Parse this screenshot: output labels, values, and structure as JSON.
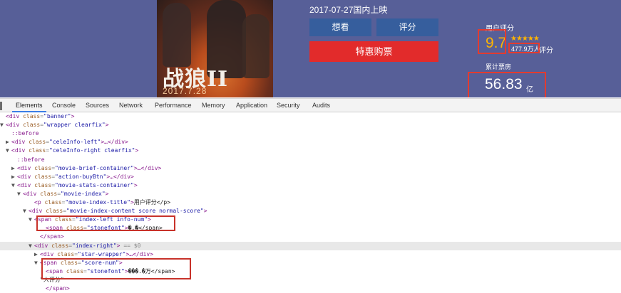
{
  "banner": {
    "poster": {
      "title_art": "战狼II",
      "date_art": "2017.7.28"
    },
    "release_text": "2017-07-27国内上映",
    "buttons": {
      "want": "想看",
      "rate": "评分",
      "buy": "特惠购票"
    },
    "score": {
      "title": "用户评分",
      "value": "9.7",
      "stars": "★★★★★",
      "count": "477.9万人",
      "count_suffix": "评分"
    },
    "box_office": {
      "title": "累计票房",
      "value": "56.83",
      "unit": "亿"
    },
    "colors": {
      "banner_bg": "#575f98",
      "button_blue": "#365e9d",
      "buy_red": "#e22b2b",
      "score_gold": "#ffb400",
      "highlight_red": "#e33b2f"
    }
  },
  "devtools": {
    "tabs": [
      "Elements",
      "Console",
      "Sources",
      "Network",
      "Performance",
      "Memory",
      "Application",
      "Security",
      "Audits"
    ],
    "active_tab": "Elements",
    "dom": [
      {
        "arrow": "",
        "pre": "<",
        "tag": "div",
        "attrs": [
          [
            "class",
            "banner"
          ]
        ],
        "post": ">",
        "text": ""
      },
      {
        "arrow": "▼",
        "pre": "<",
        "tag": "div",
        "attrs": [
          [
            "class",
            "wrapper clearfix"
          ]
        ],
        "post": ">",
        "text": ""
      },
      {
        "pseudo": "::before"
      },
      {
        "arrow": "▶",
        "pre": "<",
        "tag": "div",
        "attrs": [
          [
            "class",
            "celeInfo-left"
          ]
        ],
        "post": ">…</div>",
        "text": ""
      },
      {
        "arrow": "▼",
        "pre": "<",
        "tag": "div",
        "attrs": [
          [
            "class",
            "celeInfo-right clearfix"
          ]
        ],
        "post": ">",
        "text": ""
      },
      {
        "pseudo": "::before"
      },
      {
        "arrow": "▶",
        "pre": "<",
        "tag": "div",
        "attrs": [
          [
            "class",
            "movie-brief-container"
          ]
        ],
        "post": ">…</div>",
        "text": ""
      },
      {
        "arrow": "▶",
        "pre": "<",
        "tag": "div",
        "attrs": [
          [
            "class",
            "action-buyBtn"
          ]
        ],
        "post": ">…</div>",
        "text": ""
      },
      {
        "arrow": "▼",
        "pre": "<",
        "tag": "div",
        "attrs": [
          [
            "class",
            "movie-stats-container"
          ]
        ],
        "post": ">",
        "text": ""
      },
      {
        "arrow": "▼",
        "pre": "<",
        "tag": "div",
        "attrs": [
          [
            "class",
            "movie-index"
          ]
        ],
        "post": ">",
        "text": ""
      },
      {
        "arrow": "",
        "pre": "<",
        "tag": "p",
        "attrs": [
          [
            "class",
            "movie-index-title"
          ]
        ],
        "post": ">",
        "text": "用户评分</p>"
      },
      {
        "arrow": "▼",
        "pre": "<",
        "tag": "div",
        "attrs": [
          [
            "class",
            "movie-index-content score normal-score"
          ]
        ],
        "post": ">",
        "text": ""
      },
      {
        "arrow": "▼",
        "pre": "<",
        "tag": "span",
        "attrs": [
          [
            "class",
            "index-left info-num"
          ]
        ],
        "post": ">",
        "text": ""
      },
      {
        "arrow": "",
        "pre": "<",
        "tag": "span",
        "attrs": [
          [
            "class",
            "stonefont"
          ]
        ],
        "post": ">",
        "text": "�.�</span>"
      },
      {
        "arrow": "",
        "pre": "</",
        "tag": "span",
        "attrs": [],
        "post": ">",
        "text": ""
      },
      {
        "arrow": "▼",
        "pre": "<",
        "tag": "div",
        "attrs": [
          [
            "class",
            "index-right"
          ]
        ],
        "post": ">",
        "text": "",
        "suffix": " == $0"
      },
      {
        "arrow": "▶",
        "pre": "<",
        "tag": "div",
        "attrs": [
          [
            "class",
            "star-wrapper"
          ]
        ],
        "post": ">…</div>",
        "text": ""
      },
      {
        "arrow": "▼",
        "pre": "<",
        "tag": "span",
        "attrs": [
          [
            "class",
            "score-num"
          ]
        ],
        "post": ">",
        "text": ""
      },
      {
        "arrow": "",
        "pre": "<",
        "tag": "span",
        "attrs": [
          [
            "class",
            "stonefont"
          ]
        ],
        "post": ">",
        "text": "���.�万</span>"
      },
      {
        "raw": "\"人评分\""
      },
      {
        "arrow": "",
        "pre": "</",
        "tag": "span",
        "attrs": [],
        "post": ">",
        "text": ""
      }
    ]
  }
}
